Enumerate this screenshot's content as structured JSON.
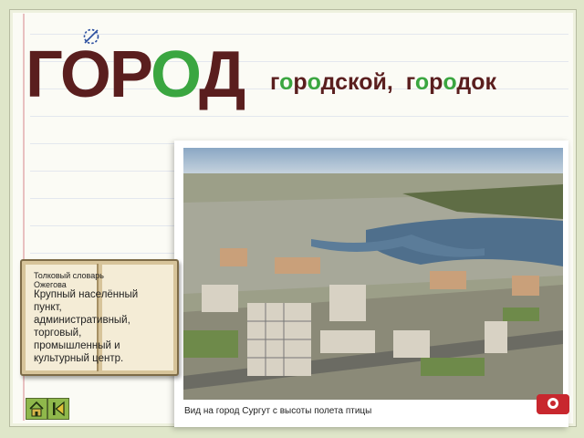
{
  "title": {
    "part1": "ГОР",
    "part2": "О",
    "part3": "Д"
  },
  "derived": {
    "w1": {
      "a": "г",
      "b": "о",
      "c": "р",
      "d": "о",
      "e": "дской,"
    },
    "w2": {
      "a": "г",
      "b": "о",
      "c": "р",
      "d": "о",
      "e": "док"
    }
  },
  "dictionary": {
    "source": "Толковый словарь Ожегова",
    "definition": "Крупный населённый пункт, административный, торговый, промышленный и культурный центр."
  },
  "photo": {
    "caption": "Вид на город Сургут с высоты полета птицы"
  },
  "nav": {
    "home_icon": "home-icon",
    "back_icon": "back-icon"
  },
  "colors": {
    "accent": "#3aa640",
    "title": "#5a1e1e"
  }
}
